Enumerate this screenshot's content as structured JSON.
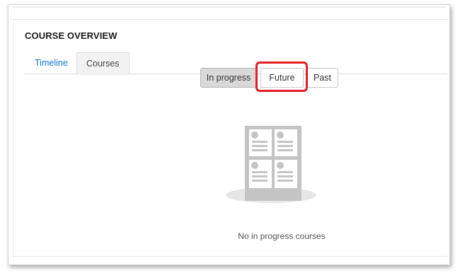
{
  "block": {
    "title": "COURSE OVERVIEW"
  },
  "tabs": [
    {
      "label": "Timeline",
      "active": false
    },
    {
      "label": "Courses",
      "active": true
    }
  ],
  "filters": {
    "in_progress": "In progress",
    "future": "Future",
    "past": "Past",
    "selected": "In progress",
    "highlighted": "Future"
  },
  "empty_state": {
    "icon": "courses-placeholder-icon",
    "message": "No in progress courses"
  },
  "colors": {
    "link_blue": "#1177d1",
    "highlight_red": "#e41c23",
    "selected_gray": "#d9d9d9",
    "illustration_gray": "#c4c4c4"
  }
}
